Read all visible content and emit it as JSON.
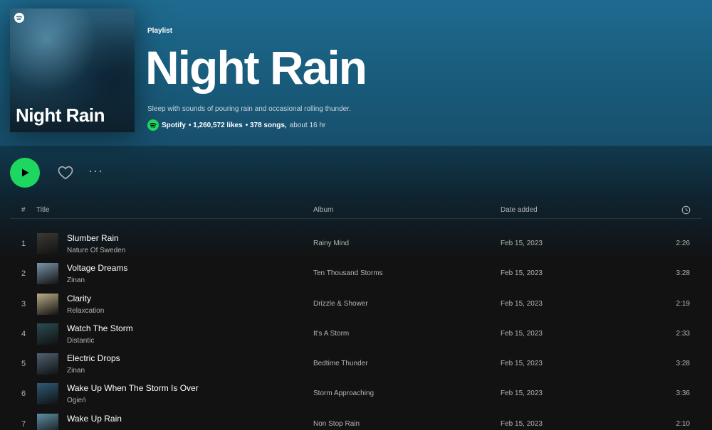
{
  "playlist": {
    "cover_title": "Night Rain",
    "type_label": "Playlist",
    "title": "Night Rain",
    "description": "Sleep with sounds of pouring rain and occasional rolling thunder.",
    "owner": "Spotify",
    "likes": "• 1,260,572 likes",
    "songs": "• 378 songs,",
    "duration": "about 16 hr"
  },
  "colors": {
    "accent": "#1ed760",
    "hero": "#1e6b90",
    "background": "#121212"
  },
  "controls": {
    "play_icon": "play-icon",
    "like_icon": "heart-icon",
    "more_label": "···"
  },
  "table": {
    "headers": {
      "index": "#",
      "title": "Title",
      "album": "Album",
      "date_added": "Date added",
      "duration_icon": "clock-icon"
    },
    "rows": [
      {
        "num": "1",
        "title": "Slumber Rain",
        "artist": "Nature Of Sweden",
        "album": "Rainy Mind",
        "date": "Feb 15, 2023",
        "duration": "2:26",
        "thumb": "#3b3a33"
      },
      {
        "num": "2",
        "title": "Voltage Dreams",
        "artist": "Zinan",
        "album": "Ten Thousand Storms",
        "date": "Feb 15, 2023",
        "duration": "3:28",
        "thumb": "#7b93a8"
      },
      {
        "num": "3",
        "title": "Clarity",
        "artist": "Relaxcation",
        "album": "Drizzle & Shower",
        "date": "Feb 15, 2023",
        "duration": "2:19",
        "thumb": "#b9ac86"
      },
      {
        "num": "4",
        "title": "Watch The Storm",
        "artist": "Distantic",
        "album": "It's A Storm",
        "date": "Feb 15, 2023",
        "duration": "2:33",
        "thumb": "#2b4c52"
      },
      {
        "num": "5",
        "title": "Electric Drops",
        "artist": "Zinan",
        "album": "Bedtime Thunder",
        "date": "Feb 15, 2023",
        "duration": "3:28",
        "thumb": "#4f6273"
      },
      {
        "num": "6",
        "title": "Wake Up When The Storm Is Over",
        "artist": "Ogień",
        "album": "Storm Approaching",
        "date": "Feb 15, 2023",
        "duration": "3:36",
        "thumb": "#2f5a78"
      },
      {
        "num": "7",
        "title": "Wake Up Rain",
        "artist": "",
        "album": "Non Stop Rain",
        "date": "Feb 15, 2023",
        "duration": "2:10",
        "thumb": "#5d8fa6"
      }
    ]
  }
}
